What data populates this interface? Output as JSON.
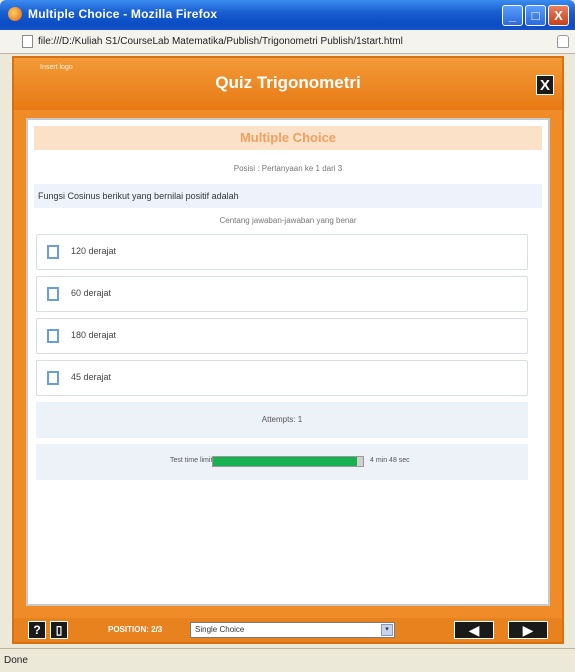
{
  "window": {
    "title": "Multiple Choice - Mozilla Firefox",
    "minimize": "_",
    "maximize": "□",
    "close": "X",
    "url": "file:///D:/Kuliah S1/CourseLab Matematika/Publish/Trigonometri Publish/1start.html",
    "status": "Done"
  },
  "quiz": {
    "small_label": "Insert logo",
    "title": "Quiz Trigonometri",
    "close": "X",
    "card_title": "Multiple Choice",
    "position_text": "Posisi : Pertanyaan ke 1 dari 3",
    "question": "Fungsi Cosinus berikut yang bernilai positif adalah",
    "instruction": "Centang jawaban-jawaban yang benar",
    "options": [
      {
        "label": "120 derajat"
      },
      {
        "label": "60 derajat"
      },
      {
        "label": "180 derajat"
      },
      {
        "label": "45 derajat"
      }
    ],
    "attempts": "Attempts: 1",
    "time_label": "Test time limit",
    "time_value": "4 min 48 sec",
    "time_progress": 0.96
  },
  "footer": {
    "help": "?",
    "page": "▯",
    "position": "POSITION: 2/3",
    "select_value": "Single Choice",
    "dropdown": "▾",
    "prev": "◀",
    "next": "▶"
  }
}
